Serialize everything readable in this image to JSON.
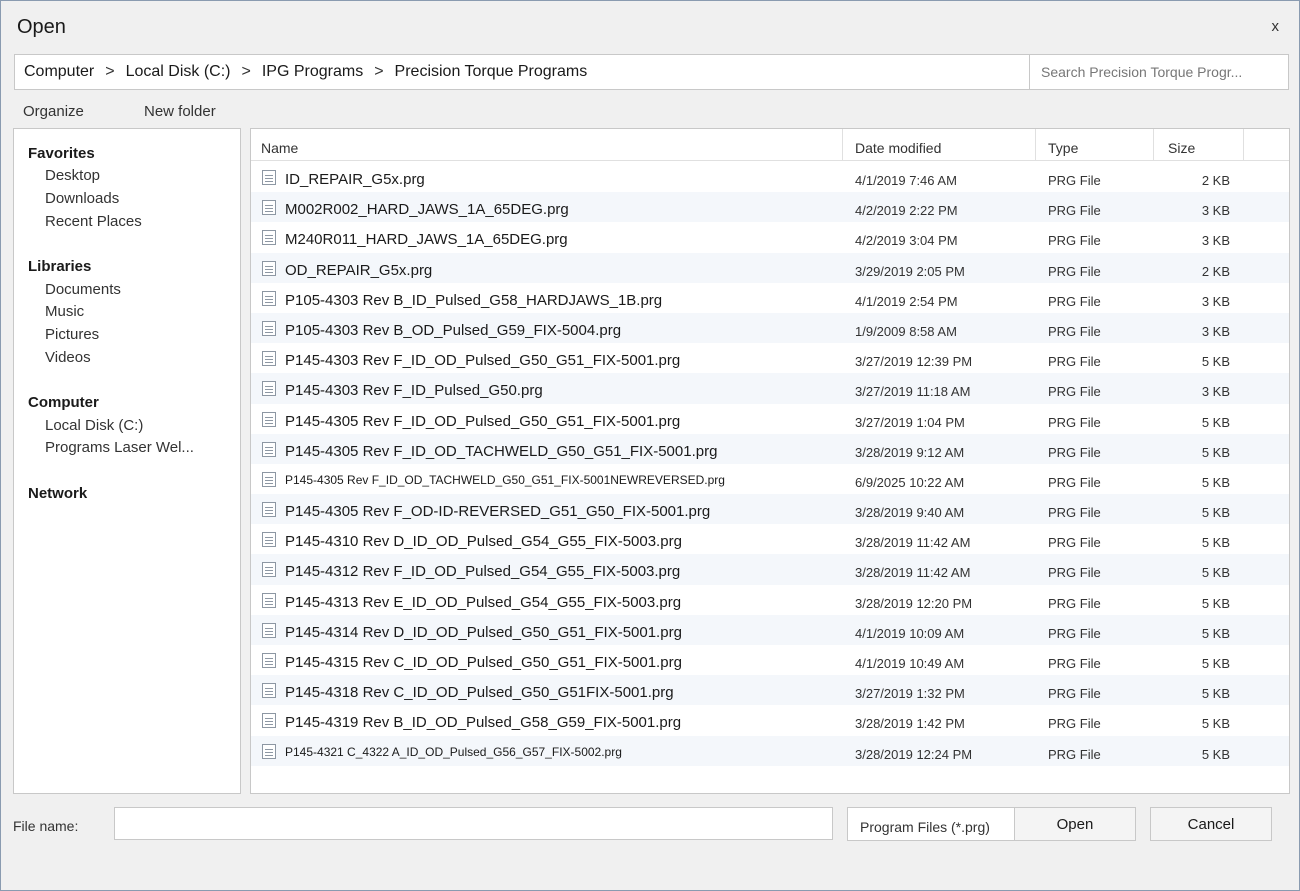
{
  "window": {
    "title": "Open",
    "close_glyph": "x"
  },
  "breadcrumb": [
    "Computer",
    "Local Disk (C:)",
    "IPG Programs",
    "Precision Torque Programs"
  ],
  "breadcrumb_separator": ">",
  "search": {
    "placeholder": "Search Precision Torque Progr..."
  },
  "toolbar": {
    "organize": "Organize",
    "new_folder": "New folder"
  },
  "nav": {
    "favorites": {
      "label": "Favorites",
      "items": [
        "Desktop",
        "Downloads",
        "Recent Places"
      ]
    },
    "libraries": {
      "label": "Libraries",
      "items": [
        "Documents",
        "Music",
        "Pictures",
        "Videos"
      ]
    },
    "computer": {
      "label": "Computer",
      "items": [
        "Local Disk (C:)",
        "Programs Laser Wel..."
      ]
    },
    "network": {
      "label": "Network"
    }
  },
  "columns": {
    "name": "Name",
    "date": "Date modified",
    "type": "Type",
    "size": "Size"
  },
  "files": [
    {
      "name": "ID_REPAIR_G5x.prg",
      "date": "4/1/2019 7:46 AM",
      "type": "PRG File",
      "size": "2 KB"
    },
    {
      "name": "M002R002_HARD_JAWS_1A_65DEG.prg",
      "date": "4/2/2019 2:22 PM",
      "type": "PRG File",
      "size": "3 KB"
    },
    {
      "name": "M240R011_HARD_JAWS_1A_65DEG.prg",
      "date": "4/2/2019 3:04 PM",
      "type": "PRG File",
      "size": "3 KB"
    },
    {
      "name": "OD_REPAIR_G5x.prg",
      "date": "3/29/2019 2:05 PM",
      "type": "PRG File",
      "size": "2 KB"
    },
    {
      "name": "P105-4303 Rev B_ID_Pulsed_G58_HARDJAWS_1B.prg",
      "date": "4/1/2019 2:54 PM",
      "type": "PRG File",
      "size": "3 KB"
    },
    {
      "name": "P105-4303 Rev B_OD_Pulsed_G59_FIX-5004.prg",
      "date": "1/9/2009 8:58 AM",
      "type": "PRG File",
      "size": "3 KB"
    },
    {
      "name": "P145-4303 Rev F_ID_OD_Pulsed_G50_G51_FIX-5001.prg",
      "date": "3/27/2019 12:39 PM",
      "type": "PRG File",
      "size": "5 KB"
    },
    {
      "name": "P145-4303 Rev F_ID_Pulsed_G50.prg",
      "date": "3/27/2019 11:18 AM",
      "type": "PRG File",
      "size": "3 KB"
    },
    {
      "name": "P145-4305 Rev F_ID_OD_Pulsed_G50_G51_FIX-5001.prg",
      "date": "3/27/2019 1:04 PM",
      "type": "PRG File",
      "size": "5 KB"
    },
    {
      "name": "P145-4305 Rev F_ID_OD_TACHWELD_G50_G51_FIX-5001.prg",
      "date": "3/28/2019 9:12 AM",
      "type": "PRG File",
      "size": "5 KB"
    },
    {
      "name": "P145-4305 Rev F_ID_OD_TACHWELD_G50_G51_FIX-5001NEWREVERSED.prg",
      "date": "6/9/2025 10:22 AM",
      "type": "PRG File",
      "size": "5 KB",
      "small": true
    },
    {
      "name": "P145-4305 Rev F_OD-ID-REVERSED_G51_G50_FIX-5001.prg",
      "date": "3/28/2019 9:40 AM",
      "type": "PRG File",
      "size": "5 KB"
    },
    {
      "name": "P145-4310 Rev D_ID_OD_Pulsed_G54_G55_FIX-5003.prg",
      "date": "3/28/2019 11:42 AM",
      "type": "PRG File",
      "size": "5 KB"
    },
    {
      "name": "P145-4312 Rev F_ID_OD_Pulsed_G54_G55_FIX-5003.prg",
      "date": "3/28/2019 11:42 AM",
      "type": "PRG File",
      "size": "5 KB"
    },
    {
      "name": "P145-4313 Rev E_ID_OD_Pulsed_G54_G55_FIX-5003.prg",
      "date": "3/28/2019 12:20 PM",
      "type": "PRG File",
      "size": "5 KB"
    },
    {
      "name": "P145-4314 Rev D_ID_OD_Pulsed_G50_G51_FIX-5001.prg",
      "date": "4/1/2019 10:09 AM",
      "type": "PRG File",
      "size": "5 KB"
    },
    {
      "name": "P145-4315 Rev C_ID_OD_Pulsed_G50_G51_FIX-5001.prg",
      "date": "4/1/2019 10:49 AM",
      "type": "PRG File",
      "size": "5 KB"
    },
    {
      "name": "P145-4318 Rev C_ID_OD_Pulsed_G50_G51FIX-5001.prg",
      "date": "3/27/2019 1:32 PM",
      "type": "PRG File",
      "size": "5 KB"
    },
    {
      "name": "P145-4319 Rev B_ID_OD_Pulsed_G58_G59_FIX-5001.prg",
      "date": "3/28/2019 1:42 PM",
      "type": "PRG File",
      "size": "5 KB"
    },
    {
      "name": "P145-4321 C_4322 A_ID_OD_Pulsed_G56_G57_FIX-5002.prg",
      "date": "3/28/2019 12:24 PM",
      "type": "PRG File",
      "size": "5 KB",
      "small": true
    }
  ],
  "footer": {
    "file_name_label": "File name:",
    "file_name_value": "",
    "filter": "Program Files (*.prg)",
    "open_button": "Open",
    "cancel_button": "Cancel"
  }
}
